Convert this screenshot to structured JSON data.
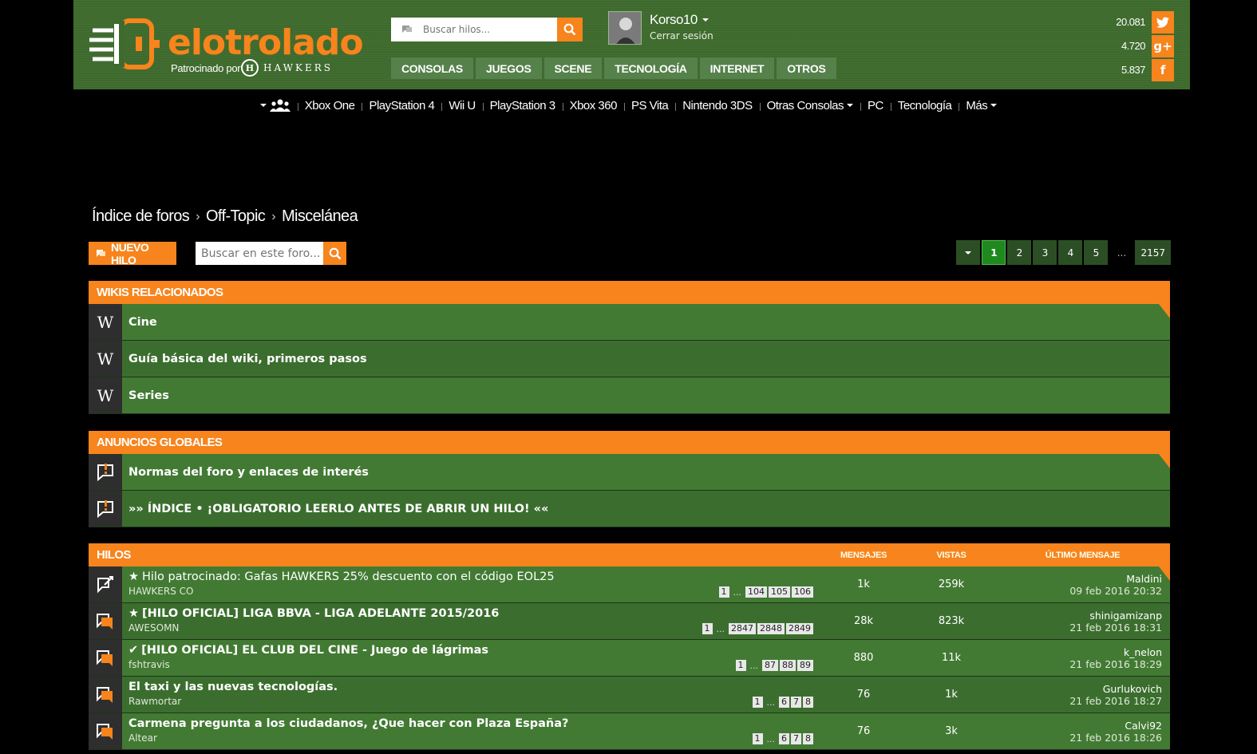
{
  "header": {
    "logo_text": "elotrolado",
    "sponsor_text": "Patrocinado por",
    "sponsor_brand": "HAWKERS",
    "search_placeholder": "Buscar hilos...",
    "nav": [
      "CONSOLAS",
      "JUEGOS",
      "SCENE",
      "TECNOLOGÍA",
      "INTERNET",
      "OTROS"
    ],
    "user": {
      "name": "Korso10",
      "logout": "Cerrar sesión"
    },
    "social": [
      {
        "count": "20.081",
        "icon": "twitter-icon",
        "glyph": "t"
      },
      {
        "count": "4.720",
        "icon": "google-plus-icon",
        "glyph": "g+"
      },
      {
        "count": "5.837",
        "icon": "facebook-icon",
        "glyph": "f"
      }
    ],
    "accent": "#f7841c",
    "bg": "#3e6a2d"
  },
  "subnav": [
    "Xbox One",
    "PlayStation 4",
    "Wii U",
    "PlayStation 3",
    "Xbox 360",
    "PS Vita",
    "Nintendo 3DS",
    "Otras Consolas",
    "PC",
    "Tecnología",
    "Más"
  ],
  "breadcrumb": [
    "Índice de foros",
    "Off-Topic",
    "Miscelánea"
  ],
  "toolbar": {
    "new_thread": "NUEVO HILO",
    "forum_search_placeholder": "Buscar en este foro..."
  },
  "pagination": [
    "1",
    "2",
    "3",
    "4",
    "5",
    "...",
    "2157"
  ],
  "wikis": {
    "title": "WIKIS RELACIONADOS",
    "items": [
      "Cine",
      "Guía básica del wiki, primeros pasos",
      "Series"
    ]
  },
  "announcements": {
    "title": "ANUNCIOS GLOBALES",
    "items": [
      "Normas del foro y enlaces de interés",
      "»» ÍNDICE • ¡OBLIGATORIO LEERLO ANTES DE ABRIR UN HILO! ««"
    ]
  },
  "threads": {
    "title": "HILOS",
    "col_messages": "MENSAJES",
    "col_views": "VISTAS",
    "col_last": "ÚLTIMO MENSAJE",
    "rows": [
      {
        "prefix": "★",
        "title": "Hilo patrocinado: Gafas HAWKERS 25% descuento con el código EOL25",
        "bold": false,
        "author": "HAWKERS CO",
        "pages": [
          "1",
          "...",
          "104",
          "105",
          "106"
        ],
        "messages": "1k",
        "views": "259k",
        "last_user": "Maldini",
        "last_date": "09 feb 2016 20:32",
        "icon": "sticky-thread-icon"
      },
      {
        "prefix": "★",
        "title": "[HILO OFICIAL] LIGA BBVA - LIGA ADELANTE 2015/2016",
        "bold": true,
        "author": "AWESOMN",
        "pages": [
          "1",
          "...",
          "2847",
          "2848",
          "2849"
        ],
        "messages": "28k",
        "views": "823k",
        "last_user": "shinigamizanp",
        "last_date": "21 feb 2016 18:31",
        "icon": "thread-icon"
      },
      {
        "prefix": "✔",
        "title": "[HILO OFICIAL] EL CLUB DEL CINE - Juego de lágrimas",
        "bold": true,
        "author": "fshtravis",
        "pages": [
          "1",
          "...",
          "87",
          "88",
          "89"
        ],
        "messages": "880",
        "views": "11k",
        "last_user": "k_nelon",
        "last_date": "21 feb 2016 18:29",
        "icon": "thread-icon"
      },
      {
        "prefix": "",
        "title": "El taxi y las nuevas tecnologías.",
        "bold": true,
        "author": "Rawmortar",
        "pages": [
          "1",
          "...",
          "6",
          "7",
          "8"
        ],
        "messages": "76",
        "views": "1k",
        "last_user": "Gurlukovich",
        "last_date": "21 feb 2016 18:27",
        "icon": "thread-icon"
      },
      {
        "prefix": "",
        "title": "Carmena pregunta a los ciudadanos, ¿Que hacer con Plaza España?",
        "bold": true,
        "author": "Altear",
        "pages": [
          "1",
          "...",
          "6",
          "7",
          "8"
        ],
        "messages": "76",
        "views": "3k",
        "last_user": "Calvi92",
        "last_date": "21 feb 2016 18:26",
        "icon": "thread-icon"
      }
    ]
  }
}
